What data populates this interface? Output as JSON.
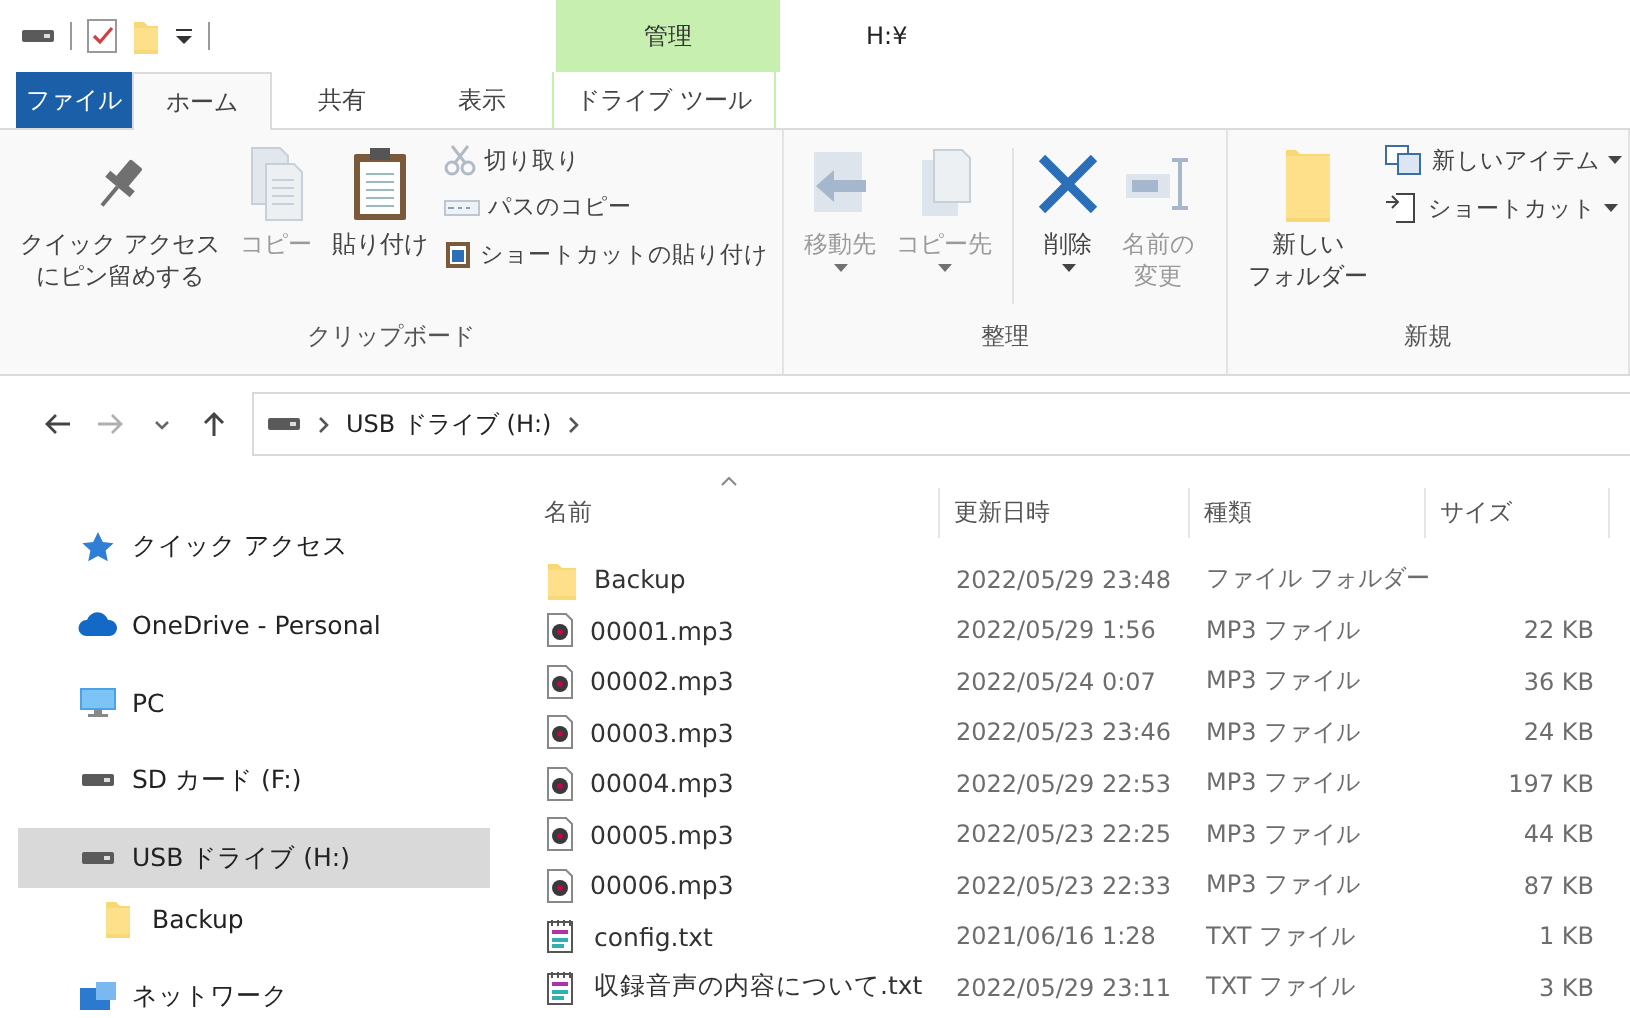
{
  "window": {
    "title": "H:¥"
  },
  "tabs": [
    {
      "label": "ファイル",
      "kind": "file",
      "selected": false
    },
    {
      "label": "ホーム",
      "kind": "normal",
      "selected": true
    },
    {
      "label": "共有",
      "kind": "normal",
      "selected": false
    },
    {
      "label": "表示",
      "kind": "normal",
      "selected": false
    },
    {
      "label": "ドライブ ツール",
      "kind": "context",
      "group": "管理",
      "selected": false
    }
  ],
  "ribbon": {
    "groups": [
      {
        "title": "クリップボード",
        "commands": [
          {
            "lines": [
              "クイック アクセス",
              "にピン留めする"
            ],
            "kind": "large",
            "disabled": false
          },
          {
            "label": "コピー",
            "kind": "large",
            "disabled": true
          },
          {
            "label": "貼り付け",
            "kind": "large",
            "disabled": false
          },
          {
            "label": "切り取り",
            "kind": "small",
            "disabled": true
          },
          {
            "label": "パスのコピー",
            "kind": "small",
            "disabled": true
          },
          {
            "label": "ショートカットの貼り付け",
            "kind": "small",
            "disabled": false
          }
        ]
      },
      {
        "title": "整理",
        "commands": [
          {
            "label": "移動先",
            "kind": "large",
            "disabled": true,
            "menu": true
          },
          {
            "label": "コピー先",
            "kind": "large",
            "disabled": true,
            "menu": true
          },
          {
            "label": "削除",
            "kind": "large",
            "disabled": false,
            "menu": true,
            "divider_before": true
          },
          {
            "lines": [
              "名前の",
              "変更"
            ],
            "kind": "large",
            "disabled": true
          }
        ]
      },
      {
        "title": "新規",
        "commands": [
          {
            "lines": [
              "新しい",
              "フォルダー"
            ],
            "kind": "large",
            "disabled": false
          },
          {
            "label": "新しいアイテム",
            "kind": "small",
            "disabled": false,
            "menu": true
          },
          {
            "label": "ショートカット",
            "kind": "small",
            "disabled": false,
            "menu": true
          }
        ]
      }
    ]
  },
  "address_bar": {
    "path": [
      "USB ドライブ (H:)"
    ]
  },
  "navigation_pane": {
    "items": [
      {
        "label": "クイック アクセス",
        "kind": "quick",
        "selected": false
      },
      {
        "label": "OneDrive - Personal",
        "kind": "cloud",
        "selected": false
      },
      {
        "label": "PC",
        "kind": "pc",
        "selected": false
      },
      {
        "label": "SD カード (F:)",
        "kind": "drive",
        "selected": false
      },
      {
        "label": "USB ドライブ (H:)",
        "kind": "drive",
        "selected": true,
        "children": [
          {
            "label": "Backup",
            "kind": "folder",
            "selected": false
          }
        ]
      },
      {
        "label": "ネットワーク",
        "kind": "network",
        "selected": false
      }
    ]
  },
  "file_list": {
    "columns": [
      {
        "label": "名前",
        "sorted": true
      },
      {
        "label": "更新日時",
        "sorted": false
      },
      {
        "label": "種類",
        "sorted": false
      },
      {
        "label": "サイズ",
        "sorted": false
      }
    ],
    "rows": [
      {
        "name": "Backup",
        "kind": "folder",
        "modified": "2022/05/29 23:48",
        "type": "ファイル フォルダー"
      },
      {
        "name": "00001.mp3",
        "kind": "audio",
        "modified": "2022/05/29 1:56",
        "type": "MP3 ファイル",
        "size": "22 KB"
      },
      {
        "name": "00002.mp3",
        "kind": "audio",
        "modified": "2022/05/24 0:07",
        "type": "MP3 ファイル",
        "size": "36 KB"
      },
      {
        "name": "00003.mp3",
        "kind": "audio",
        "modified": "2022/05/23 23:46",
        "type": "MP3 ファイル",
        "size": "24 KB"
      },
      {
        "name": "00004.mp3",
        "kind": "audio",
        "modified": "2022/05/29 22:53",
        "type": "MP3 ファイル",
        "size": "197 KB"
      },
      {
        "name": "00005.mp3",
        "kind": "audio",
        "modified": "2022/05/23 22:25",
        "type": "MP3 ファイル",
        "size": "44 KB"
      },
      {
        "name": "00006.mp3",
        "kind": "audio",
        "modified": "2022/05/23 22:33",
        "type": "MP3 ファイル",
        "size": "87 KB"
      },
      {
        "name": "config.txt",
        "kind": "text",
        "modified": "2021/06/16 1:28",
        "type": "TXT ファイル",
        "size": "1 KB"
      },
      {
        "name": "収録音声の内容について.txt",
        "kind": "text",
        "modified": "2022/05/29 23:11",
        "type": "TXT ファイル",
        "size": "3 KB"
      }
    ]
  }
}
